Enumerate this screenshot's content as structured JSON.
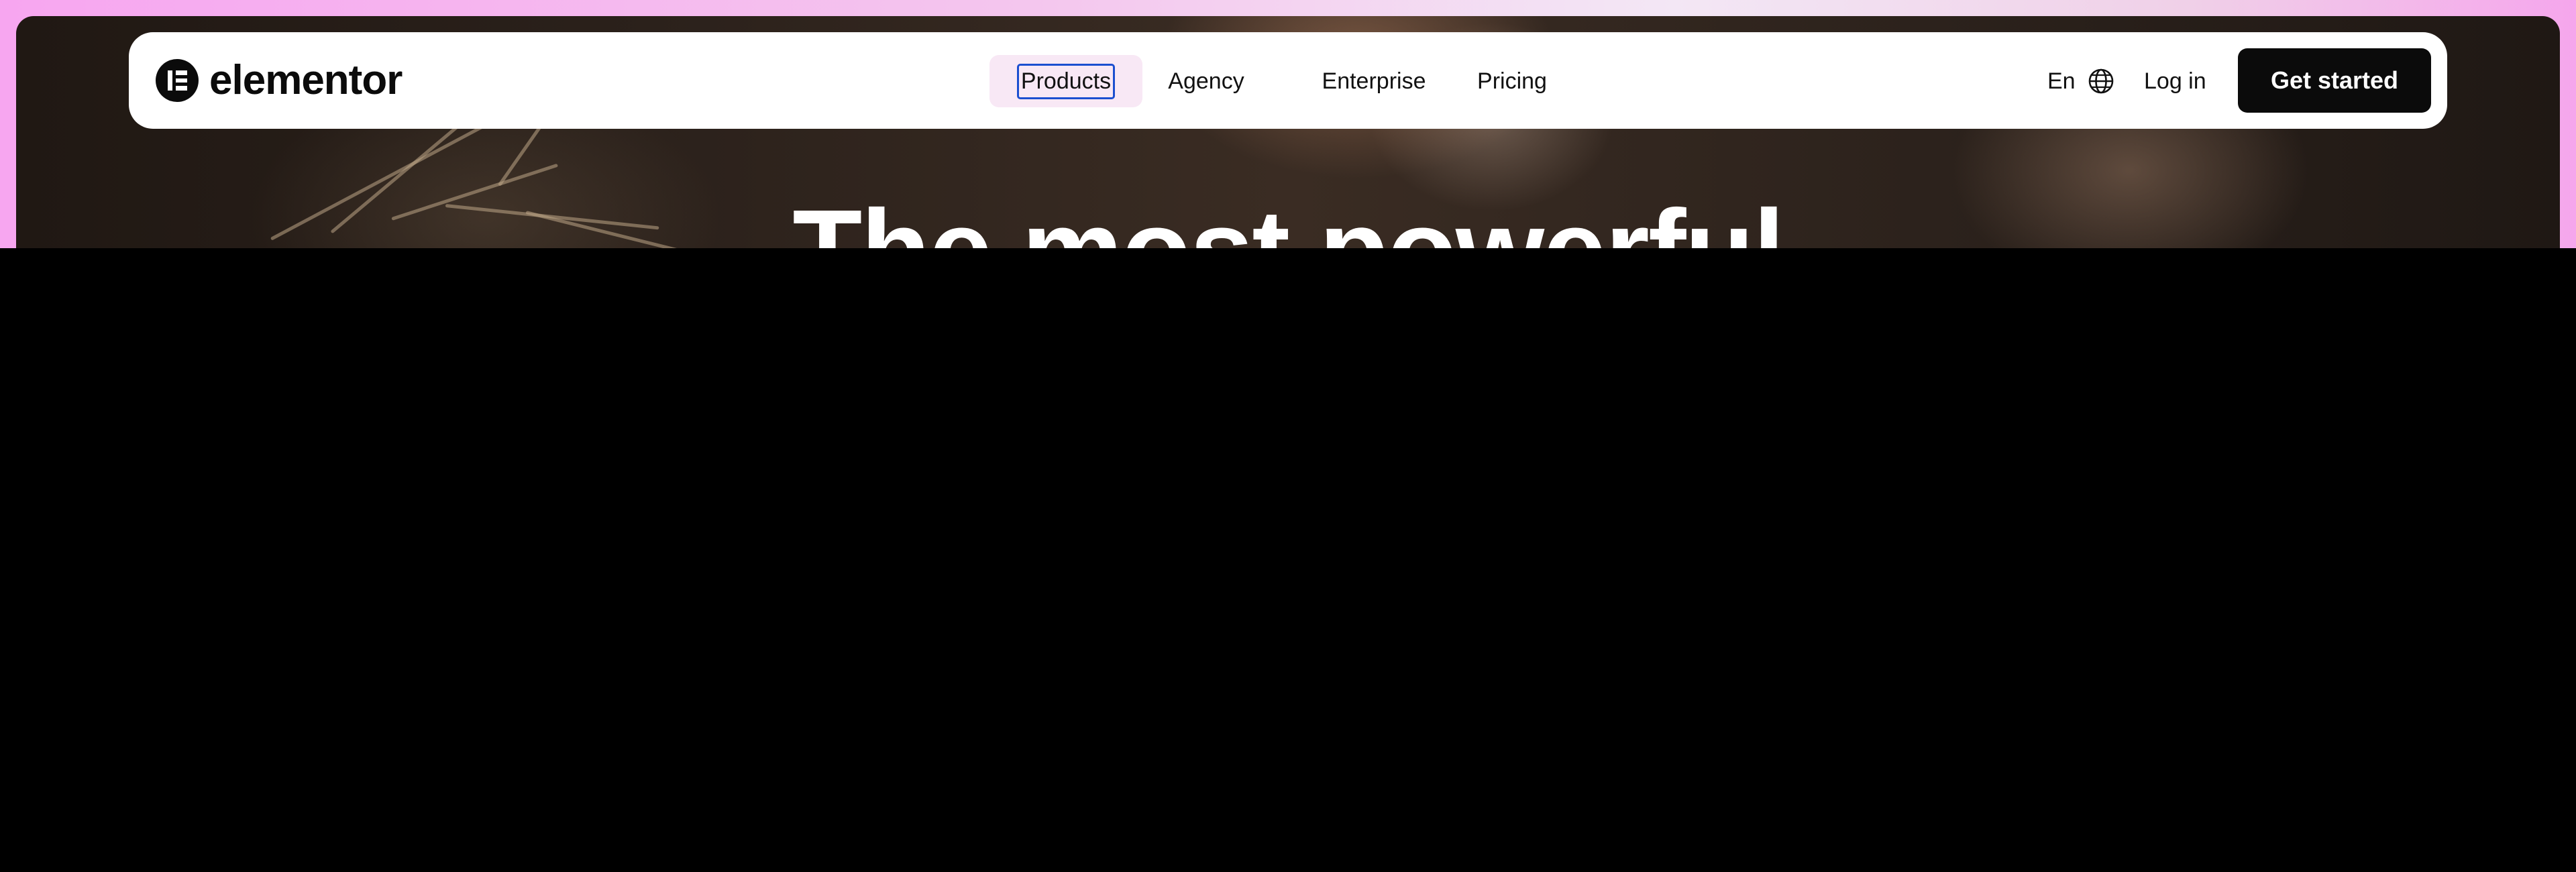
{
  "brand": {
    "name": "elementor"
  },
  "nav": {
    "items": [
      {
        "label": "Products"
      },
      {
        "label": "Agency"
      },
      {
        "label": "Enterprise"
      },
      {
        "label": "Pricing"
      }
    ],
    "language": "En",
    "login": "Log in",
    "cta": "Get started"
  },
  "hero": {
    "headline": "The most powerful"
  },
  "icons": {
    "logo": "elementor-logo-icon",
    "language": "globe-icon"
  },
  "colors": {
    "cta_bg": "#0b0b0b",
    "active_nav_bg": "#f8e8f5",
    "focus_ring": "#1b4fd0"
  }
}
